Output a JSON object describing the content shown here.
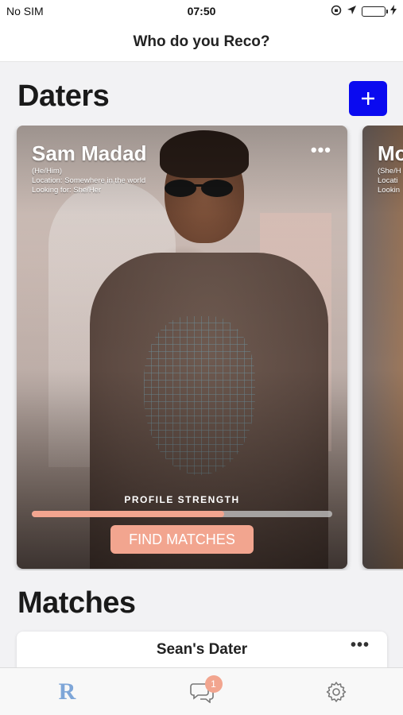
{
  "status_bar": {
    "carrier": "No SIM",
    "time": "07:50",
    "icons": [
      "screen-rotation-lock-icon",
      "location-arrow-icon",
      "battery-icon",
      "charging-bolt-icon"
    ]
  },
  "nav": {
    "title": "Who do you Reco?"
  },
  "daters_section": {
    "title": "Daters",
    "add_icon": "plus-icon"
  },
  "dater_cards": [
    {
      "name": "Sam Madad",
      "pronouns": "(He/Him)",
      "location": "Location: Somewhere in the world",
      "looking_for": "Looking for: She/Her",
      "more_label": "•••",
      "strength_label": "PROFILE STRENGTH",
      "strength_percent": 64,
      "find_button": "FIND MATCHES"
    },
    {
      "name": "Mo",
      "pronouns": "(She/H",
      "location": "Locati",
      "looking_for": "Lookin"
    }
  ],
  "matches_section": {
    "title": "Matches",
    "card_title": "Sean's Dater",
    "more_label": "•••"
  },
  "tab_bar": {
    "home_logo": "R",
    "messages_badge": "1",
    "icons": [
      "reco-logo-icon",
      "chat-bubbles-icon",
      "settings-gear-icon"
    ]
  },
  "colors": {
    "accent_blue": "#0a0af0",
    "peach": "#f2a58f",
    "logo_blue": "#7ea6d8"
  }
}
